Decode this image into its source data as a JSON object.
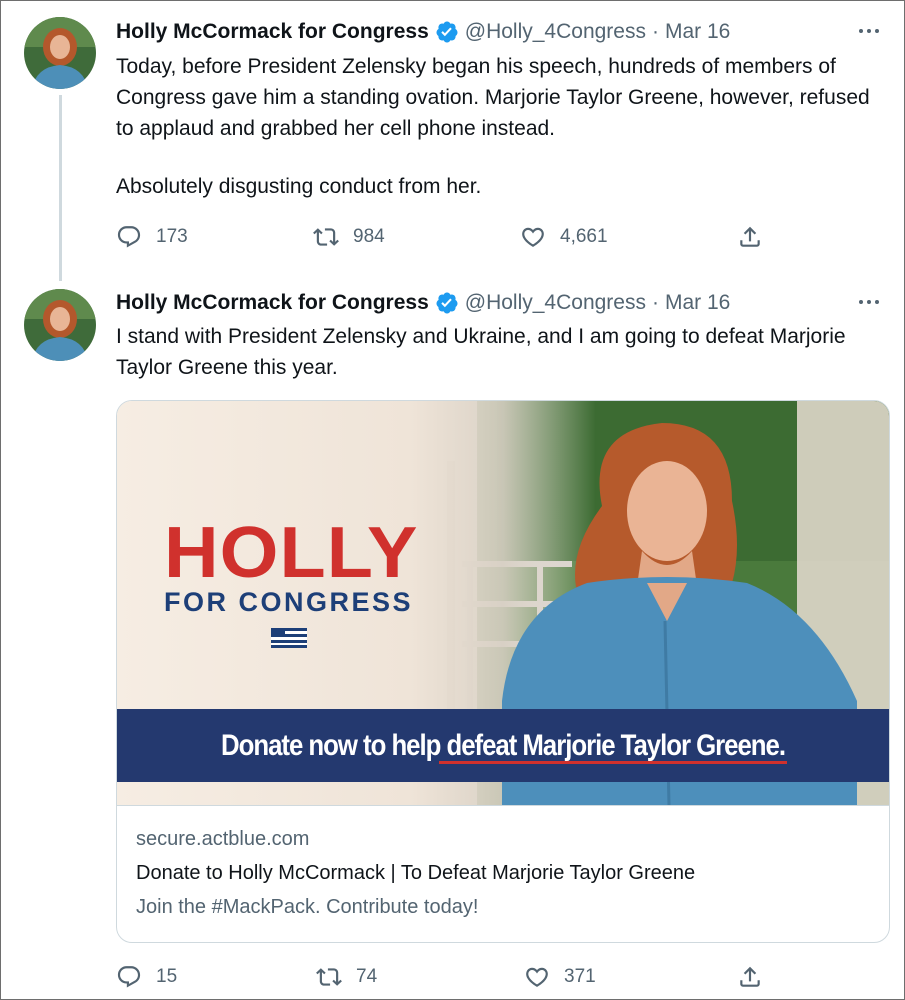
{
  "tweets": [
    {
      "author": "Holly McCormack for Congress",
      "handle": "@Holly_4Congress",
      "separator": "·",
      "date": "Mar 16",
      "paragraphs": [
        "Today, before President Zelensky began his speech, hundreds of members of Congress gave him a standing ovation. Marjorie Taylor Greene, however, refused to applaud and grabbed her cell phone instead.",
        "Absolutely disgusting conduct from her."
      ],
      "replies": "173",
      "retweets": "984",
      "likes": "4,661"
    },
    {
      "author": "Holly McCormack for Congress",
      "handle": "@Holly_4Congress",
      "separator": "·",
      "date": "Mar 16",
      "text": "I stand with President Zelensky and Ukraine, and I am going to defeat Marjorie Taylor Greene this year.",
      "replies": "15",
      "retweets": "74",
      "likes": "371"
    }
  ],
  "card": {
    "image_headline": "HOLLY",
    "image_subheadline": "FOR CONGRESS",
    "banner_text": "Donate now to help defeat Marjorie Taylor Greene.",
    "domain": "secure.actblue.com",
    "title": "Donate to Holly McCormack | To Defeat Marjorie Taylor Greene",
    "description": "Join the #MackPack. Contribute today!"
  },
  "icons": {
    "reply": "reply-icon",
    "retweet": "retweet-icon",
    "like": "heart-icon",
    "share": "share-icon",
    "more": "more-icon",
    "verified": "verified-badge-icon"
  },
  "colors": {
    "verified_blue": "#1d9bf0",
    "secondary_text": "#536471",
    "thread_line": "#cfd9de",
    "card_red": "#d0312d",
    "card_navy": "#24396f"
  }
}
